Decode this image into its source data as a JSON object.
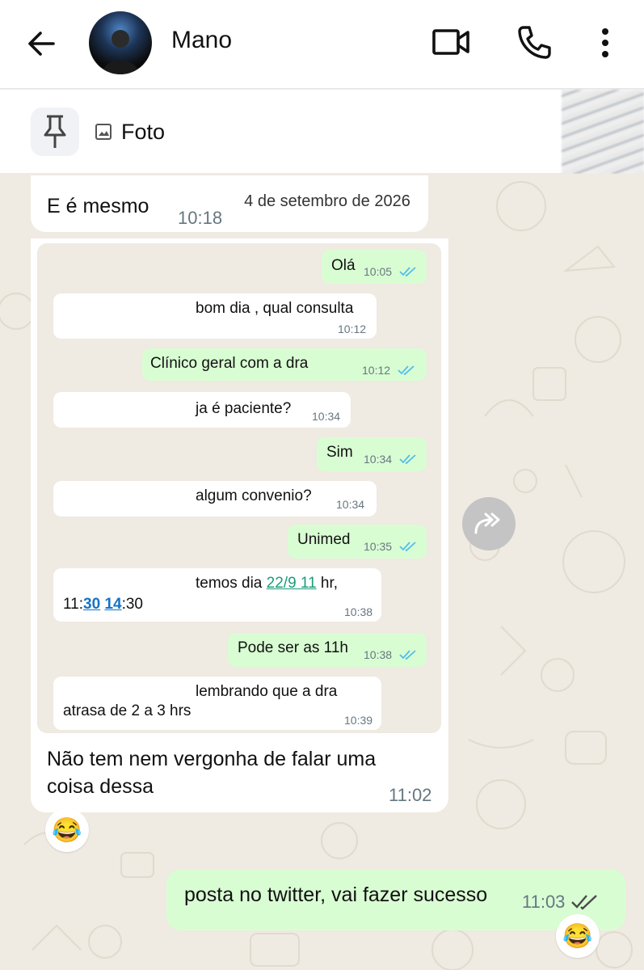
{
  "header": {
    "contact_name": "Mano",
    "icons": [
      "back-arrow-icon",
      "video-call-icon",
      "phone-icon",
      "more-options-icon"
    ]
  },
  "pinned": {
    "label": "Foto",
    "icons": [
      "pin-icon",
      "photo-icon"
    ]
  },
  "chat": {
    "quoted_message": {
      "text": "E é mesmo",
      "time": "10:18"
    },
    "screenshot": {
      "date_chip": "4 de setembro de 2026",
      "messages": [
        {
          "dir": "out",
          "text": "Olá",
          "time": "10:05"
        },
        {
          "dir": "in",
          "text": "bom dia , qual consulta",
          "time": "10:12"
        },
        {
          "dir": "out",
          "text": "Clínico geral com a dra",
          "time": "10:12"
        },
        {
          "dir": "in",
          "text": "ja é paciente?",
          "time": "10:34"
        },
        {
          "dir": "out",
          "text": "Sim",
          "time": "10:34"
        },
        {
          "dir": "in",
          "text": "algum convenio?",
          "time": "10:34"
        },
        {
          "dir": "out",
          "text": "Unimed",
          "time": "10:35"
        },
        {
          "dir": "in",
          "line1_a": "temos dia ",
          "line1_link": "22/9 11",
          "line1_b": " hr,",
          "line2_a": "11:",
          "line2_link1": "30",
          "line2_sp": " ",
          "line2_link2": "14",
          "line2_b": ":30",
          "time": "10:38"
        },
        {
          "dir": "out",
          "text": "Pode ser as 11h",
          "time": "10:38"
        },
        {
          "dir": "in",
          "line1": "lembrando que a dra",
          "line2": "atrasa de 2 a 3 hrs",
          "time": "10:39"
        }
      ]
    },
    "caption": {
      "line1": "Não tem nem vergonha de falar uma",
      "line2": "coisa dessa",
      "time": "11:02",
      "reaction": "😂"
    },
    "sent_message": {
      "text": "posta no twitter, vai fazer sucesso",
      "time": "11:03",
      "reaction": "😂"
    }
  },
  "colors": {
    "chat_bg": "#efeae2",
    "outgoing": "#d9fdd3",
    "incoming": "#ffffff",
    "read_tick": "#53bdeb",
    "link": "#1a9c7a"
  }
}
